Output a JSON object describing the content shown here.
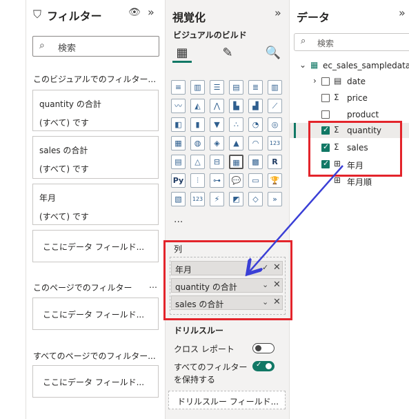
{
  "filters": {
    "title": "フィルター",
    "search_placeholder": "検索",
    "section_visual": "このビジュアルでのフィルター...",
    "cards": [
      {
        "field": "quantity の合計",
        "value": "(すべて) です"
      },
      {
        "field": "sales の合計",
        "value": "(すべて) です"
      },
      {
        "field": "年月",
        "value": "(すべて) です"
      }
    ],
    "drop_label": "ここにデータ フィールド...",
    "section_page": "このページでのフィルター",
    "section_all": "すべてのページでのフィルター...",
    "more": "…"
  },
  "viz": {
    "title": "視覚化",
    "build_label": "ビジュアルのビルド",
    "more": "...",
    "columns_label": "列",
    "column_pills": [
      "年月",
      "quantity の合計",
      "sales の合計"
    ],
    "drill_title": "ドリルスルー",
    "cross_report": "クロス レポート",
    "keep_filters": "すべてのフィルター",
    "keep_filters_2": "を保持する",
    "drill_drop": "ドリルスルー フィールド...",
    "cross_report_on": false,
    "keep_filters_on": true
  },
  "data": {
    "title": "データ",
    "search_placeholder": "検索",
    "table_name": "ec_sales_sampledata",
    "fields": [
      {
        "name": "date",
        "type": "calendar",
        "checked": false,
        "expandable": true
      },
      {
        "name": "price",
        "type": "sigma",
        "checked": false
      },
      {
        "name": "product",
        "type": "none",
        "checked": false
      },
      {
        "name": "quantity",
        "type": "sigma",
        "checked": true
      },
      {
        "name": "sales",
        "type": "sigma",
        "checked": true
      },
      {
        "name": "年月",
        "type": "calc",
        "checked": true
      },
      {
        "name": "年月順",
        "type": "calc",
        "checked": false
      }
    ]
  },
  "colors": {
    "accent": "#117865",
    "highlight": "#e3242b",
    "arrow": "#3a3fd6"
  }
}
